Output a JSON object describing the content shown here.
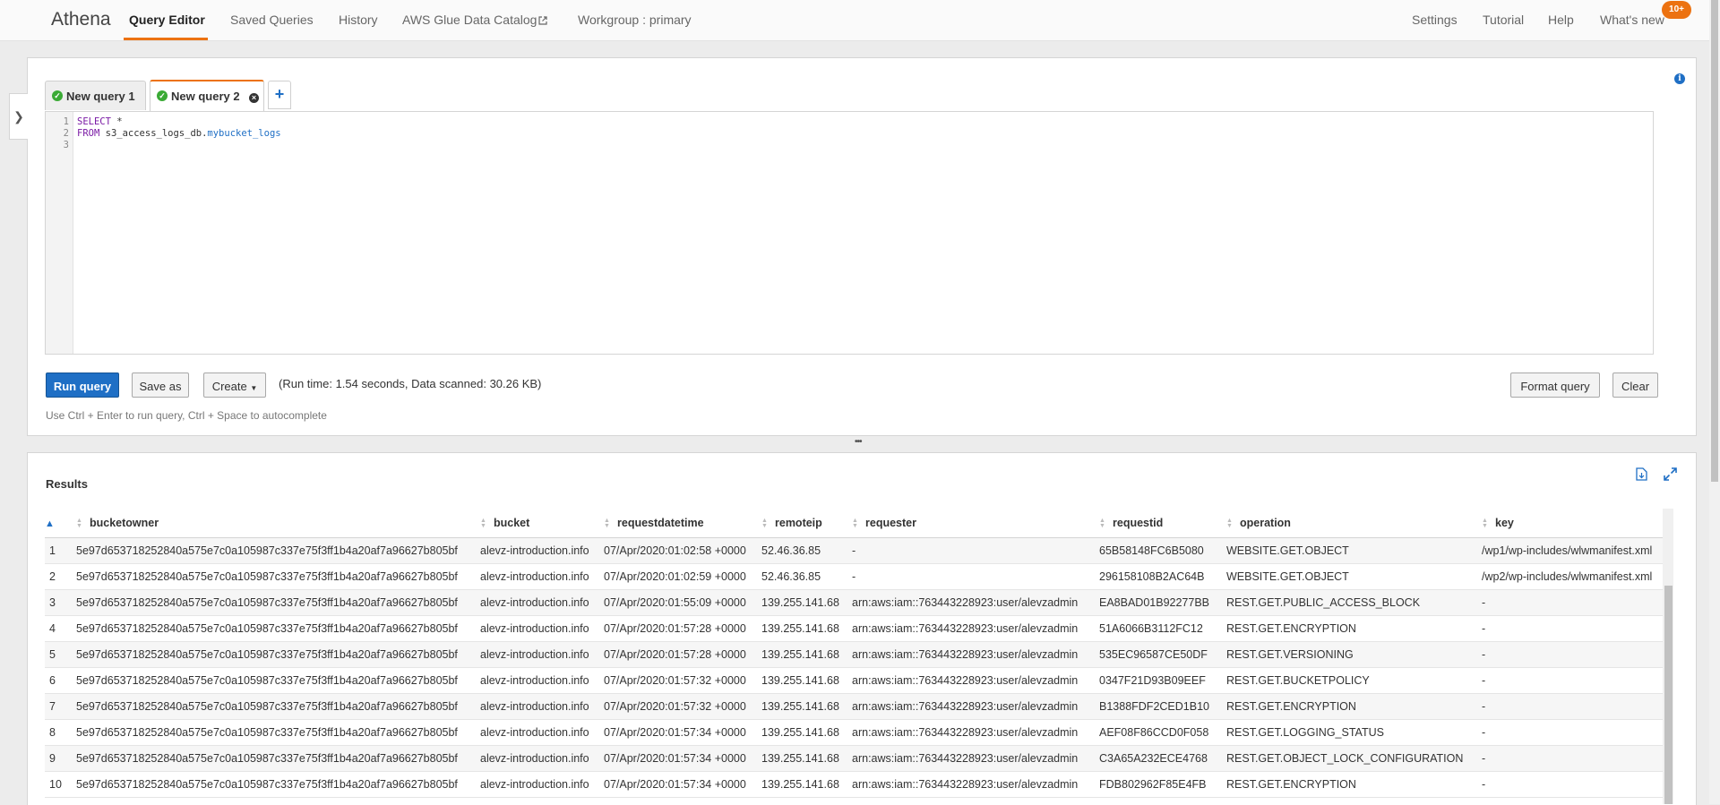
{
  "nav": {
    "brand": "Athena",
    "links": [
      "Query Editor",
      "Saved Queries",
      "History",
      "AWS Glue Data Catalog",
      "Workgroup : primary"
    ],
    "right_links": [
      "Settings",
      "Tutorial",
      "Help",
      "What's new"
    ],
    "badge": "10+"
  },
  "editor": {
    "tabs": [
      {
        "label": "New query 1",
        "active": false
      },
      {
        "label": "New query 2",
        "active": true
      }
    ],
    "line_numbers": [
      "1",
      "2",
      "3"
    ],
    "code": {
      "line1_kw": "SELECT",
      "line1_rest": " *",
      "line2_kw": "FROM",
      "line2_db": " s3_access_logs_db.",
      "line2_table": "mybucket_logs"
    },
    "buttons": {
      "run": "Run query",
      "save_as": "Save as",
      "create": "Create",
      "format": "Format query",
      "clear": "Clear"
    },
    "run_info": "(Run time: 1.54 seconds, Data scanned: 30.26 KB)",
    "hint": "Use Ctrl + Enter to run query, Ctrl + Space to autocomplete"
  },
  "results": {
    "title": "Results",
    "columns": [
      "bucketowner",
      "bucket",
      "requestdatetime",
      "remoteip",
      "requester",
      "requestid",
      "operation",
      "key"
    ],
    "rows": [
      [
        "1",
        "5e97d653718252840a575e7c0a105987c337e75f3ff1b4a20af7a96627b805bf",
        "alevz-introduction.info",
        "07/Apr/2020:01:02:58 +0000",
        "52.46.36.85",
        "-",
        "65B58148FC6B5080",
        "WEBSITE.GET.OBJECT",
        "/wp1/wp-includes/wlwmanifest.xml"
      ],
      [
        "2",
        "5e97d653718252840a575e7c0a105987c337e75f3ff1b4a20af7a96627b805bf",
        "alevz-introduction.info",
        "07/Apr/2020:01:02:59 +0000",
        "52.46.36.85",
        "-",
        "296158108B2AC64B",
        "WEBSITE.GET.OBJECT",
        "/wp2/wp-includes/wlwmanifest.xml"
      ],
      [
        "3",
        "5e97d653718252840a575e7c0a105987c337e75f3ff1b4a20af7a96627b805bf",
        "alevz-introduction.info",
        "07/Apr/2020:01:55:09 +0000",
        "139.255.141.68",
        "arn:aws:iam::763443228923:user/alevzadmin",
        "EA8BAD01B92277BB",
        "REST.GET.PUBLIC_ACCESS_BLOCK",
        "-"
      ],
      [
        "4",
        "5e97d653718252840a575e7c0a105987c337e75f3ff1b4a20af7a96627b805bf",
        "alevz-introduction.info",
        "07/Apr/2020:01:57:28 +0000",
        "139.255.141.68",
        "arn:aws:iam::763443228923:user/alevzadmin",
        "51A6066B3112FC12",
        "REST.GET.ENCRYPTION",
        "-"
      ],
      [
        "5",
        "5e97d653718252840a575e7c0a105987c337e75f3ff1b4a20af7a96627b805bf",
        "alevz-introduction.info",
        "07/Apr/2020:01:57:28 +0000",
        "139.255.141.68",
        "arn:aws:iam::763443228923:user/alevzadmin",
        "535EC96587CE50DF",
        "REST.GET.VERSIONING",
        "-"
      ],
      [
        "6",
        "5e97d653718252840a575e7c0a105987c337e75f3ff1b4a20af7a96627b805bf",
        "alevz-introduction.info",
        "07/Apr/2020:01:57:32 +0000",
        "139.255.141.68",
        "arn:aws:iam::763443228923:user/alevzadmin",
        "0347F21D93B09EEF",
        "REST.GET.BUCKETPOLICY",
        "-"
      ],
      [
        "7",
        "5e97d653718252840a575e7c0a105987c337e75f3ff1b4a20af7a96627b805bf",
        "alevz-introduction.info",
        "07/Apr/2020:01:57:32 +0000",
        "139.255.141.68",
        "arn:aws:iam::763443228923:user/alevzadmin",
        "B1388FDF2CED1B10",
        "REST.GET.ENCRYPTION",
        "-"
      ],
      [
        "8",
        "5e97d653718252840a575e7c0a105987c337e75f3ff1b4a20af7a96627b805bf",
        "alevz-introduction.info",
        "07/Apr/2020:01:57:34 +0000",
        "139.255.141.68",
        "arn:aws:iam::763443228923:user/alevzadmin",
        "AEF08F86CCD0F058",
        "REST.GET.LOGGING_STATUS",
        "-"
      ],
      [
        "9",
        "5e97d653718252840a575e7c0a105987c337e75f3ff1b4a20af7a96627b805bf",
        "alevz-introduction.info",
        "07/Apr/2020:01:57:34 +0000",
        "139.255.141.68",
        "arn:aws:iam::763443228923:user/alevzadmin",
        "C3A65A232ECE4768",
        "REST.GET.OBJECT_LOCK_CONFIGURATION",
        "-"
      ],
      [
        "10",
        "5e97d653718252840a575e7c0a105987c337e75f3ff1b4a20af7a96627b805bf",
        "alevz-introduction.info",
        "07/Apr/2020:01:57:34 +0000",
        "139.255.141.68",
        "arn:aws:iam::763443228923:user/alevzadmin",
        "FDB802962F85E4FB",
        "REST.GET.ENCRYPTION",
        "-"
      ]
    ]
  },
  "colors": {
    "accent": "#ec7211",
    "primary": "#1f6fc5",
    "success": "#3aaa35"
  }
}
